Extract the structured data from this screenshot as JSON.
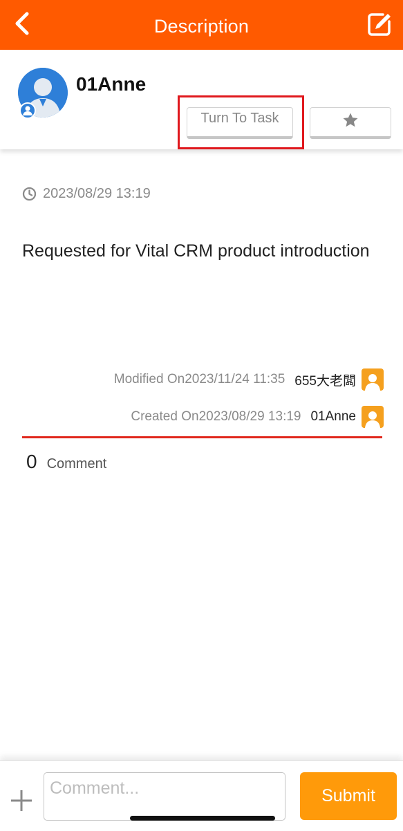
{
  "header": {
    "title": "Description",
    "back_icon": "chevron-left-icon",
    "edit_icon": "edit-square-icon",
    "color": "#ff5a00"
  },
  "author": {
    "name": "01Anne",
    "avatar_icon": "person-avatar-icon",
    "avatar_color": "#2e7fd8",
    "turn_to_task_label": "Turn To Task",
    "star_icon": "star-icon",
    "highlight_color": "#e0181d"
  },
  "post": {
    "date": "2023/08/29 13:19",
    "clock_icon": "clock-icon",
    "description": "Requested for Vital CRM product introduction"
  },
  "meta": {
    "modified_label": "Modified On2023/11/24 11:35",
    "modified_user": "655大老闆",
    "created_label": "Created On2023/08/29 13:19",
    "created_user": "01Anne",
    "user_icon": "user-avatar-icon",
    "user_icon_color": "#f5a01e"
  },
  "comments": {
    "count": "0",
    "label": "Comment",
    "divider_color": "#e0281d"
  },
  "composer": {
    "placeholder": "Comment...",
    "submit_label": "Submit",
    "plus_icon": "plus-icon",
    "submit_color": "#ff9a0a"
  }
}
